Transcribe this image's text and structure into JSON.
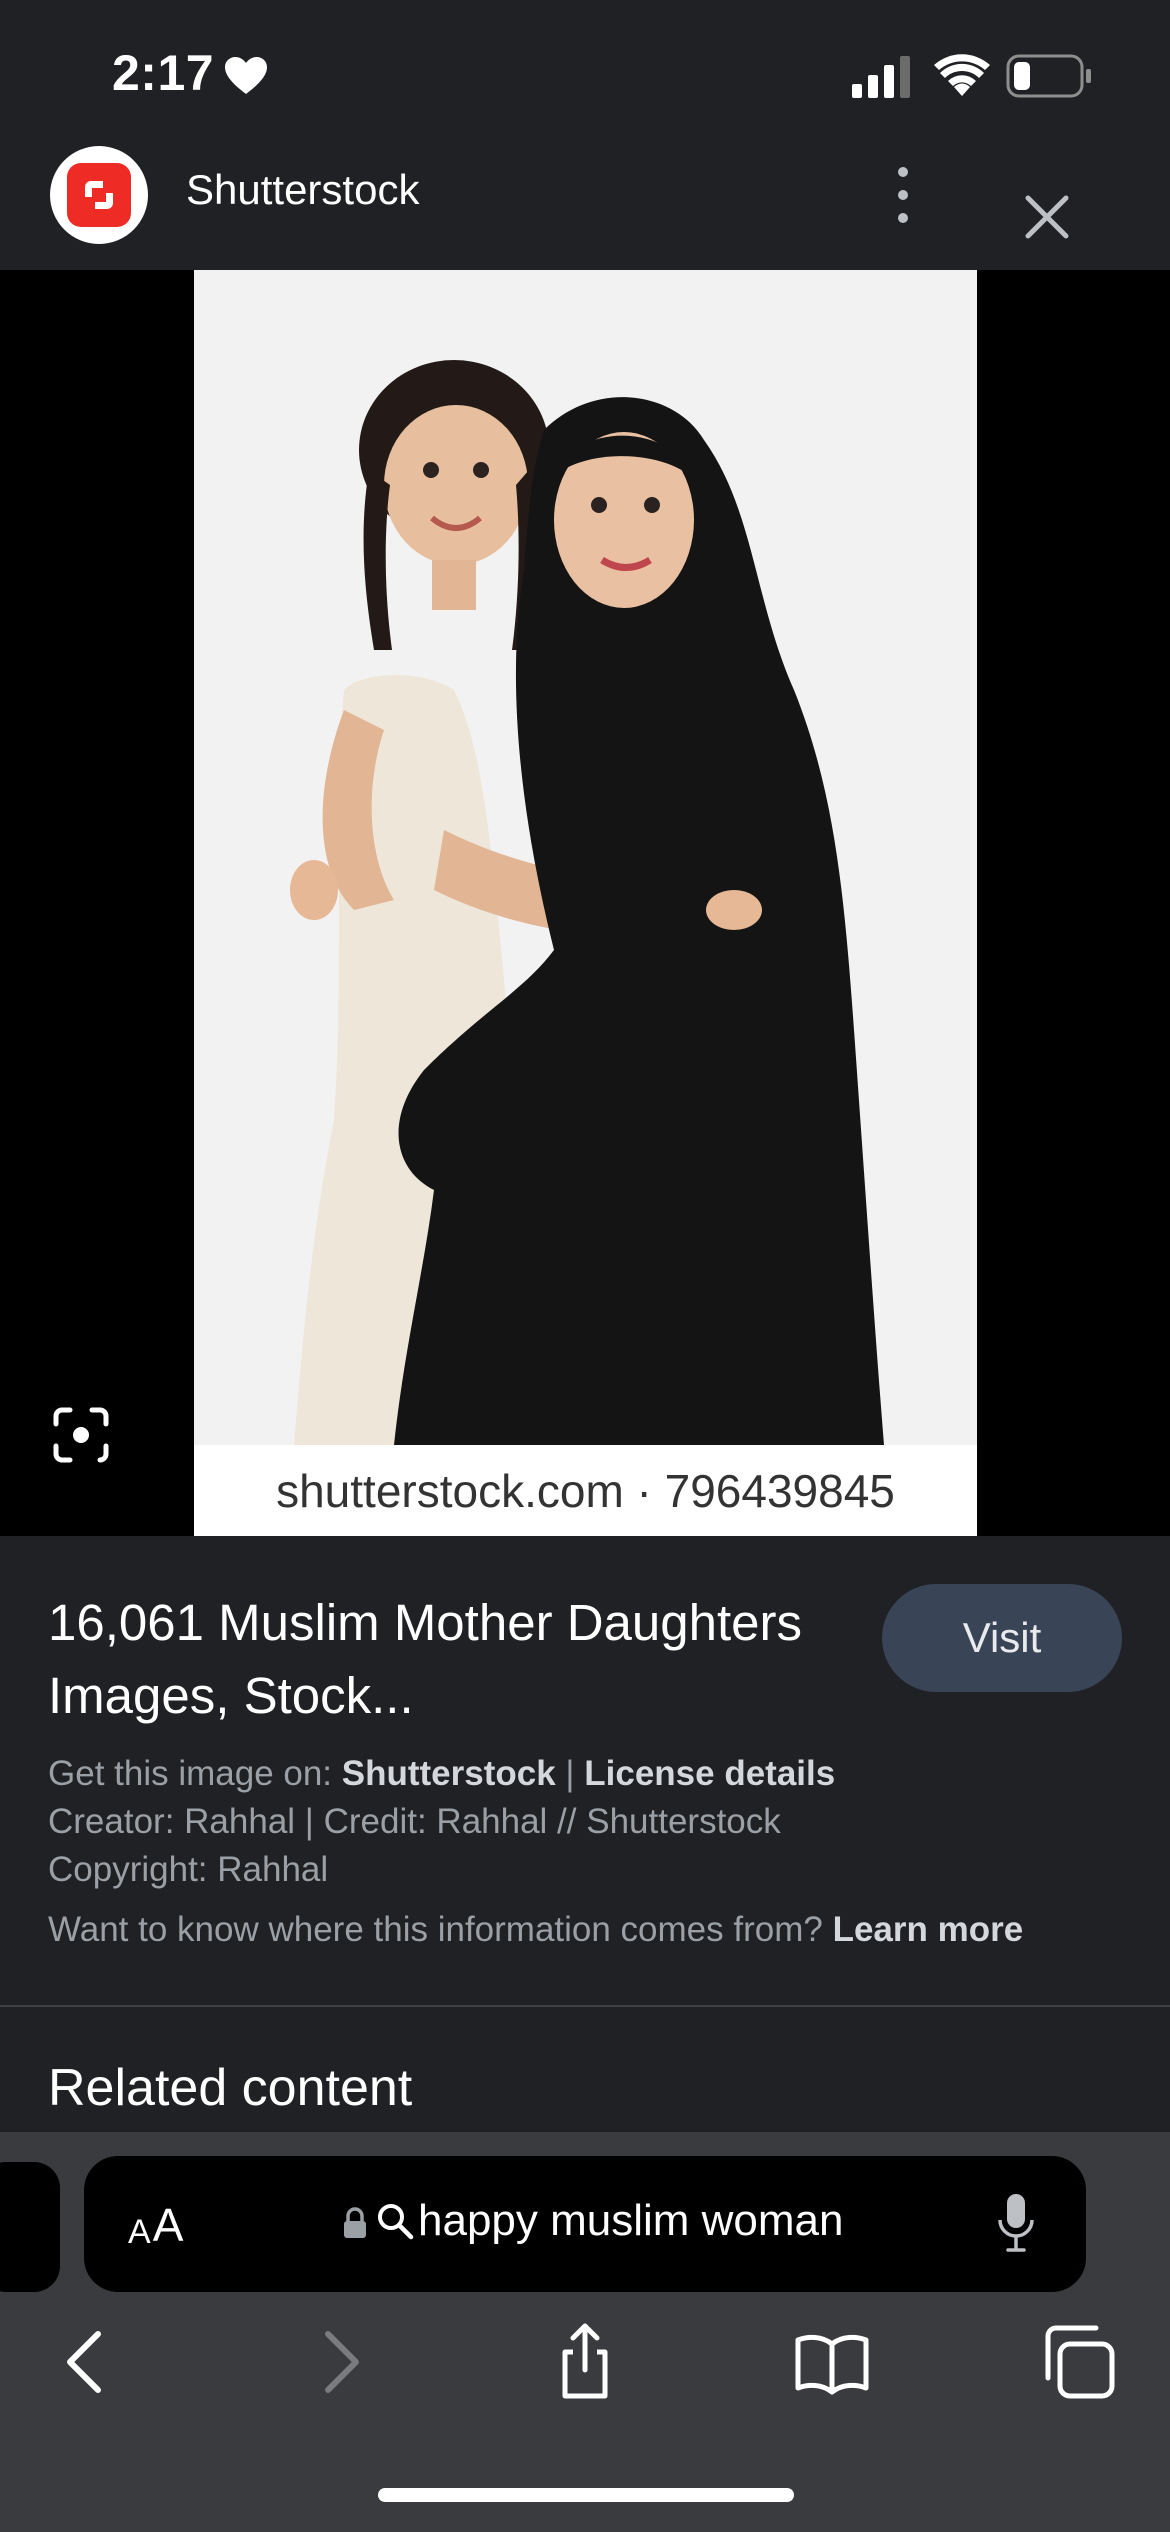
{
  "status_bar": {
    "time": "2:17",
    "icons": [
      "heart-icon",
      "cellular-signal-icon",
      "wifi-icon",
      "battery-icon"
    ],
    "battery_level": 0.2
  },
  "header": {
    "site_name": "Shutterstock",
    "logo_icon": "shutterstock-logo",
    "menu_icon": "more-vertical-icon",
    "close_icon": "close-icon"
  },
  "image": {
    "watermark": "shutterstock.com · 796439845",
    "lens_icon": "google-lens-icon"
  },
  "result": {
    "title": "16,061 Muslim Mother Daughters Images, Stock...",
    "visit_label": "Visit",
    "get_image_prefix": "Get this image on: ",
    "source_link": "Shutterstock",
    "separator": " | ",
    "license_link": "License details",
    "creator_line": "Creator: Rahhal | Credit: Rahhal // Shutterstock",
    "copyright_line": "Copyright: Rahhal",
    "info_question": "Want to know where this information comes from? ",
    "learn_more": "Learn more"
  },
  "related": {
    "heading": "Related content"
  },
  "browser": {
    "text_size_label_small": "A",
    "text_size_label_large": "A",
    "address_text": "happy muslim woman",
    "nav_icons": [
      "back-icon",
      "forward-icon",
      "share-icon",
      "bookmarks-icon",
      "tabs-icon"
    ]
  },
  "colors": {
    "background": "#202124",
    "visit_button": "#394457",
    "brand_red": "#ee2b24",
    "browser_chrome": "#3a3b3e"
  }
}
